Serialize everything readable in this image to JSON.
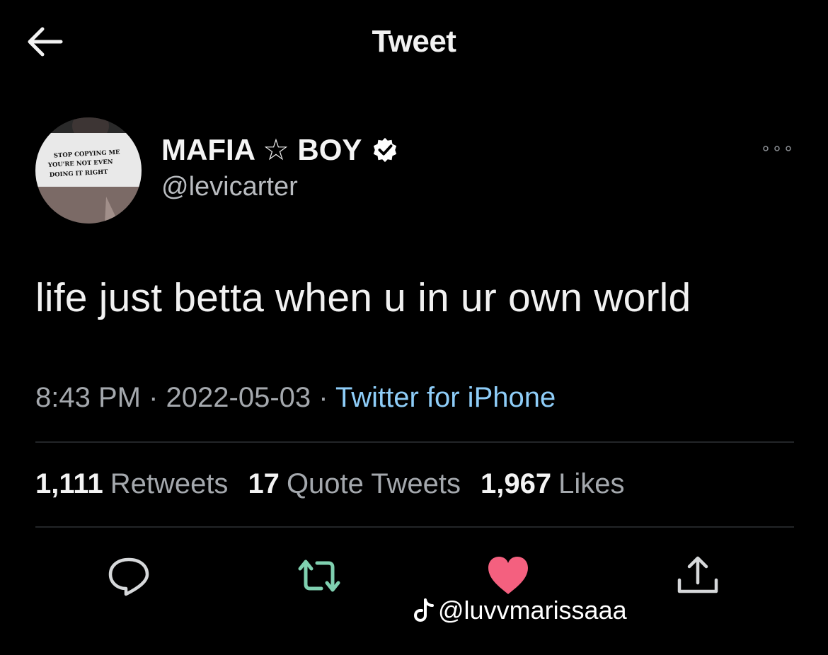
{
  "header": {
    "title": "Tweet",
    "back_icon": "arrow-left-icon"
  },
  "author": {
    "display_name": "MAFIA ☆ BOY",
    "handle": "@levicarter",
    "avatar_shirt_text": [
      "STOP COPYING ME",
      "YOU'RE NOT EVEN",
      "DOING IT RIGHT"
    ],
    "verified": true
  },
  "tweet": {
    "text": "life just betta when u in ur own world",
    "time": "8:43 PM",
    "date": "2022-05-03",
    "source": "Twitter for iPhone"
  },
  "stats": {
    "retweets_count": "1,111",
    "retweets_label": "Retweets",
    "quotes_count": "17",
    "quotes_label": "Quote Tweets",
    "likes_count": "1,967",
    "likes_label": "Likes"
  },
  "actions": [
    "reply-icon",
    "retweet-icon",
    "like-icon",
    "share-icon"
  ],
  "watermark": {
    "text": "@luvvmarissaaa",
    "icon": "tiktok-icon"
  },
  "colors": {
    "background": "#000000",
    "link": "#8ecdf8",
    "like": "#f4607f",
    "retweet": "#7fd0b0",
    "verified_badge": "#ffffff"
  }
}
